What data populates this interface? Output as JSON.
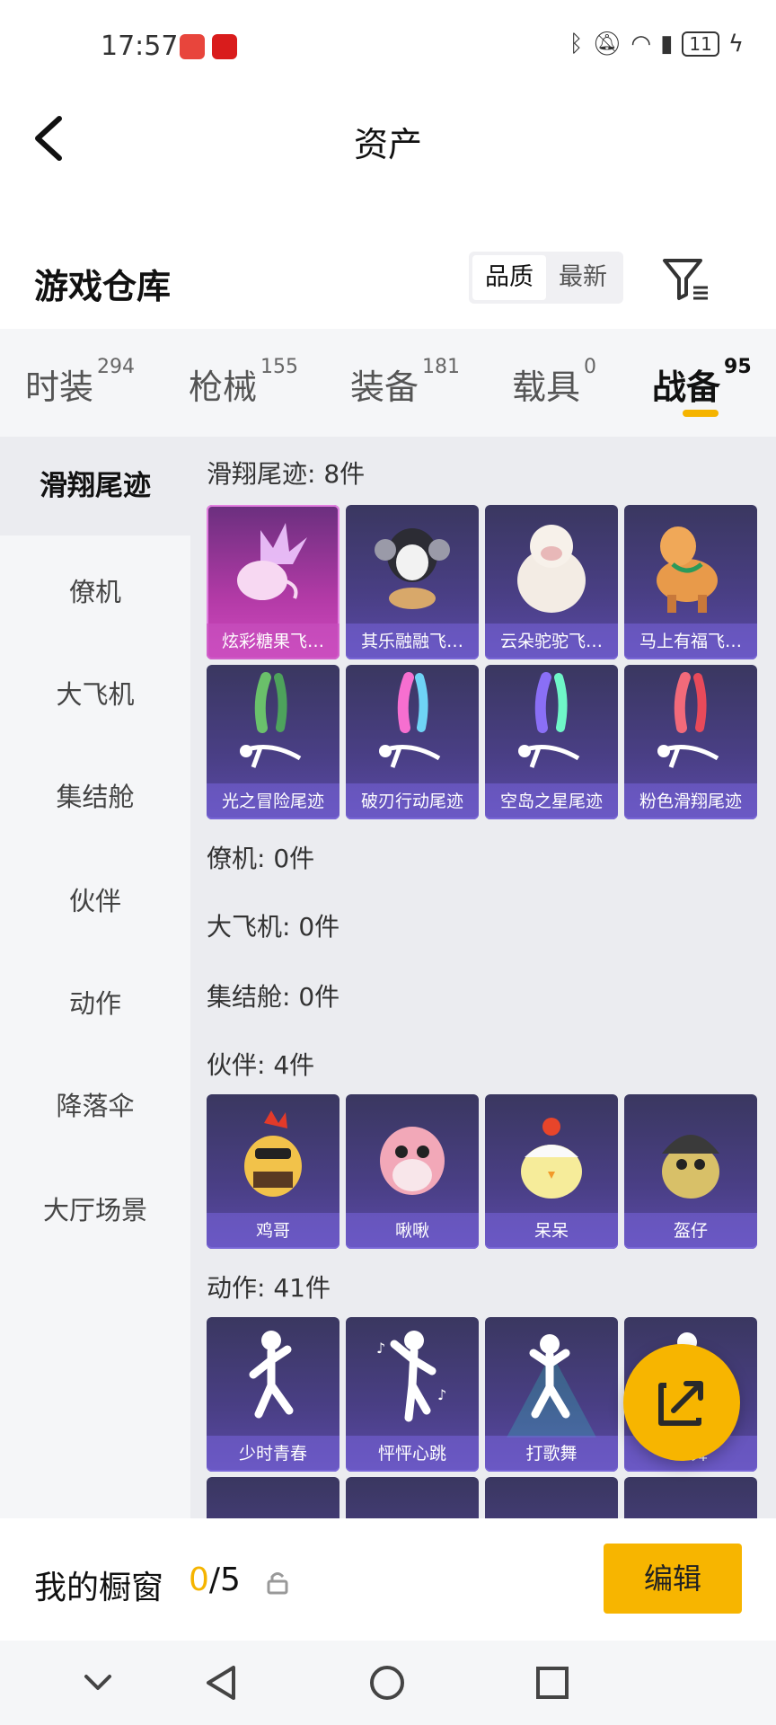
{
  "status_bar": {
    "time": "17:57",
    "battery": "11",
    "icons": [
      "bluetooth-icon",
      "mute-bell-icon",
      "wifi-icon",
      "alert-icon",
      "battery-icon",
      "charging-icon"
    ]
  },
  "header": {
    "title": "资产"
  },
  "warehouse": {
    "title": "游戏仓库",
    "sort_options": [
      "品质",
      "最新"
    ],
    "sort_selected": "品质"
  },
  "tabs": [
    {
      "label": "时装",
      "count": "294"
    },
    {
      "label": "枪械",
      "count": "155"
    },
    {
      "label": "装备",
      "count": "181"
    },
    {
      "label": "载具",
      "count": "0"
    },
    {
      "label": "战备",
      "count": "95",
      "active": true
    }
  ],
  "sidebar": {
    "items": [
      "滑翔尾迹",
      "僚机",
      "大飞机",
      "集结舱",
      "伙伴",
      "动作",
      "降落伞",
      "大厅场景"
    ]
  },
  "sections": [
    {
      "label": "滑翔尾迹: 8件",
      "items": [
        "炫彩糖果飞…",
        "其乐融融飞…",
        "云朵驼驼飞…",
        "马上有福飞…",
        "光之冒险尾迹",
        "破刃行动尾迹",
        "空岛之星尾迹",
        "粉色滑翔尾迹"
      ]
    },
    {
      "label": "僚机: 0件"
    },
    {
      "label": "大飞机: 0件"
    },
    {
      "label": "集结舱: 0件"
    },
    {
      "label": "伙伴: 4件",
      "items": [
        "鸡哥",
        "啾啾",
        "呆呆",
        "盔仔"
      ]
    },
    {
      "label": "动作: 41件",
      "items": [
        "少时青春",
        "怦怦心跳",
        "打歌舞",
        "…舞"
      ]
    }
  ],
  "showcase": {
    "title": "我的橱窗",
    "used": "0",
    "total": "/5",
    "edit_label": "编辑"
  },
  "colors": {
    "accent": "#f7b500",
    "card_bg": "#4a3f86",
    "card_highlight": "#d24ac0"
  }
}
